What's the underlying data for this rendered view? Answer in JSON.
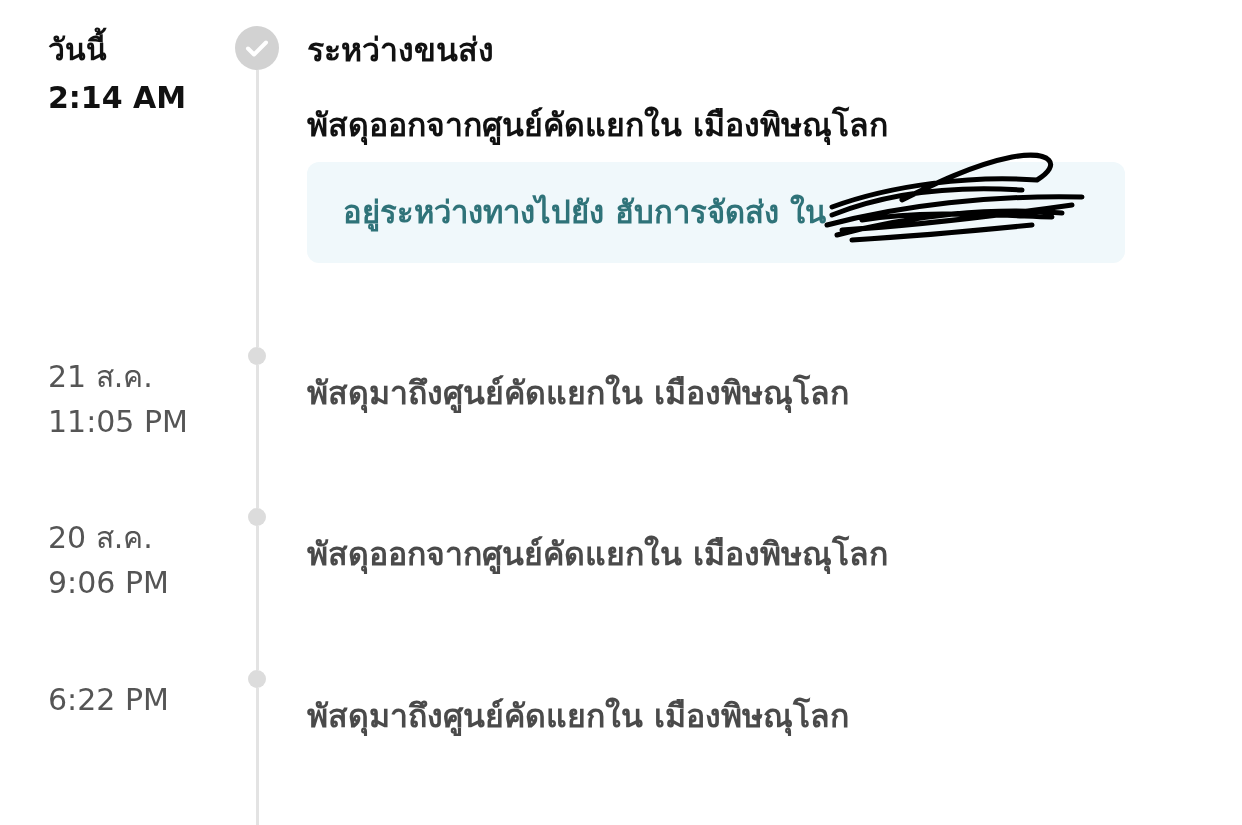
{
  "events": [
    {
      "current": true,
      "date": "วันนี้",
      "time": "2:14 AM",
      "status": "ระหว่างขนส่ง",
      "description": "พัสดุออกจากศูนย์คัดแยกใน เมืองพิษณุโลก",
      "note": "อยู่ระหว่างทางไปยัง ฮับการจัดส่ง ใน"
    },
    {
      "current": false,
      "date": "21 ส.ค.",
      "time": "11:05 PM",
      "description": "พัสดุมาถึงศูนย์คัดแยกใน เมืองพิษณุโลก"
    },
    {
      "current": false,
      "date": "20 ส.ค.",
      "time": "9:06 PM",
      "description": "พัสดุออกจากศูนย์คัดแยกใน เมืองพิษณุโลก"
    },
    {
      "current": false,
      "time": "6:22 PM",
      "description": "พัสดุมาถึงศูนย์คัดแยกใน เมืองพิษณุโลก"
    }
  ]
}
